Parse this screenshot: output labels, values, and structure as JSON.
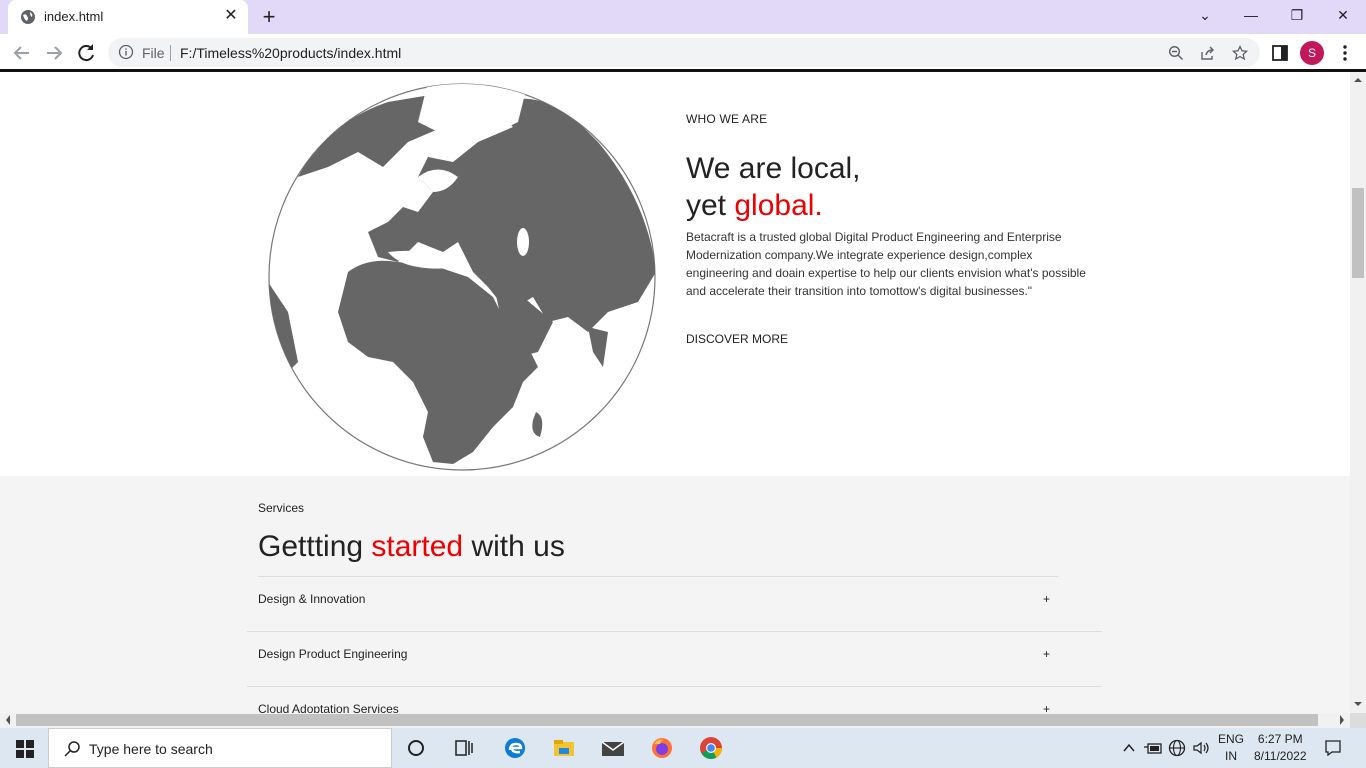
{
  "browser": {
    "tab_title": "index.html",
    "close_symbol": "✕",
    "newtab_symbol": "+",
    "omnibox_scheme": "File",
    "omnibox_url": "F:/Timeless%20products/index.html",
    "profile_initial": "S",
    "icons": {
      "favicon": "globe-icon",
      "back": "back-arrow-icon",
      "forward": "forward-arrow-icon",
      "reload": "reload-icon",
      "info": "info-icon",
      "zoom": "zoom-icon",
      "share": "share-icon",
      "bookmark": "star-icon",
      "sidepanel": "side-panel-icon",
      "menu": "kebab-menu-icon"
    }
  },
  "window_controls": {
    "dropdown": "⌄",
    "minimize": "—",
    "restore": "❐",
    "close": "✕"
  },
  "hero": {
    "who_label": "WHO WE ARE",
    "headline_line1": "We are local,",
    "headline_yet": "yet ",
    "headline_accent": "global.",
    "description": "Betacraft is a trusted global Digital Product Engineering and Enterprise Modernization company.We integrate experience design,complex engineering and doain expertise to help our clients envision what's possible and accelerate their transition into tomottow's digital businesses.\"",
    "discover_label": "DISCOVER MORE",
    "accent_color": "#e00000"
  },
  "services": {
    "label": "Services",
    "title_start": "Gettting ",
    "title_accent": "started",
    "title_end": " with us",
    "items": [
      {
        "label": "Design & Innovation",
        "symbol": "+"
      },
      {
        "label": "Design Product Engineering",
        "symbol": "+"
      },
      {
        "label": "Cloud Adoptation Services",
        "symbol": "+"
      }
    ]
  },
  "taskbar": {
    "search_placeholder": "Type here to search",
    "language_line1": "ENG",
    "language_line2": "IN",
    "time": "6:27 PM",
    "date": "8/11/2022",
    "apps": [
      "cortana-icon",
      "task-view-icon",
      "edge-icon",
      "file-explorer-icon",
      "mail-icon",
      "firefox-icon",
      "chrome-icon"
    ]
  }
}
